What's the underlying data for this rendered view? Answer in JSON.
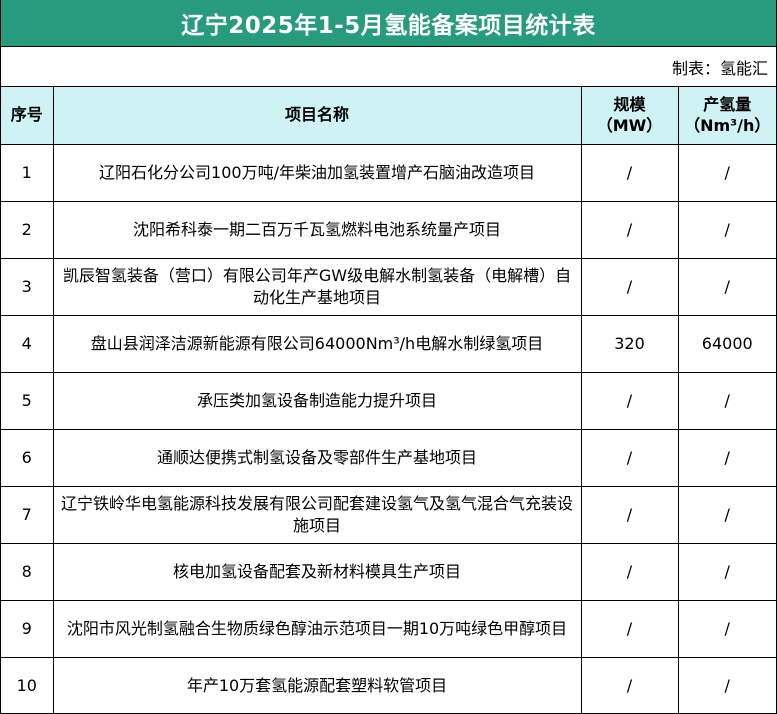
{
  "title": "辽宁2025年1-5月氢能备案项目统计表",
  "maker": "制表：氢能汇",
  "headers": {
    "index": "序号",
    "name": "项目名称",
    "scale_line1": "规模",
    "scale_line2": "（MW）",
    "h2_line1": "产氢量",
    "h2_line2": "（Nm³/h）"
  },
  "rows": [
    {
      "index": "1",
      "name": "辽阳石化分公司100万吨/年柴油加氢装置增产石脑油改造项目",
      "scale": "/",
      "h2": "/"
    },
    {
      "index": "2",
      "name": "沈阳希科泰一期二百万千瓦氢燃料电池系统量产项目",
      "scale": "/",
      "h2": "/"
    },
    {
      "index": "3",
      "name": "凯辰智氢装备（营口）有限公司年产GW级电解水制氢装备（电解槽）自动化生产基地项目",
      "scale": "/",
      "h2": "/"
    },
    {
      "index": "4",
      "name": "盘山县润泽洁源新能源有限公司64000Nm³/h电解水制绿氢项目",
      "scale": "320",
      "h2": "64000"
    },
    {
      "index": "5",
      "name": "承压类加氢设备制造能力提升项目",
      "scale": "/",
      "h2": "/"
    },
    {
      "index": "6",
      "name": "通顺达便携式制氢设备及零部件生产基地项目",
      "scale": "/",
      "h2": "/"
    },
    {
      "index": "7",
      "name": "辽宁铁岭华电氢能源科技发展有限公司配套建设氢气及氢气混合气充装设施项目",
      "scale": "/",
      "h2": "/"
    },
    {
      "index": "8",
      "name": "核电加氢设备配套及新材料模具生产项目",
      "scale": "/",
      "h2": "/"
    },
    {
      "index": "9",
      "name": "沈阳市风光制氢融合生物质绿色醇油示范项目一期10万吨绿色甲醇项目",
      "scale": "/",
      "h2": "/"
    },
    {
      "index": "10",
      "name": "年产10万套氢能源配套塑料软管项目",
      "scale": "/",
      "h2": "/"
    }
  ]
}
